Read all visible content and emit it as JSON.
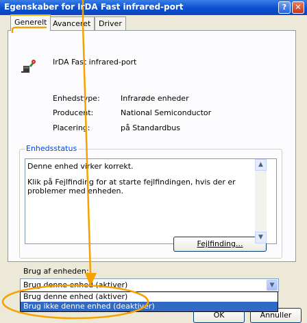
{
  "window": {
    "title": "Egenskaber for IrDA Fast infrared-port",
    "help_glyph": "?",
    "close_glyph": "✕"
  },
  "tabs": [
    {
      "label": "Generelt",
      "selected": true
    },
    {
      "label": "Avanceret",
      "selected": false
    },
    {
      "label": "Driver",
      "selected": false
    }
  ],
  "device": {
    "name": "IrDA Fast infrared-port",
    "icon": "infrared-device-icon"
  },
  "properties": [
    {
      "label": "Enhedstype:",
      "value": "Infrarøde enheder"
    },
    {
      "label": "Producent:",
      "value": "National Semiconductor"
    },
    {
      "label": "Placering:",
      "value": "på Standardbus"
    }
  ],
  "status": {
    "group_title": "Enhedsstatus",
    "line1": "Denne enhed virker korrekt.",
    "line2": "Klik på Fejlfinding for at starte fejlfindingen, hvis der er problemer med enheden.",
    "troubleshoot_button": "Fejlfinding..."
  },
  "usage": {
    "label": "Brug af enheden:",
    "selected_value": "Brug denne enhed (aktiver)",
    "options": [
      "Brug denne enhed (aktiver)",
      "Brug ikke denne enhed (deaktiver)"
    ],
    "highlighted_option_index": 1
  },
  "buttons": {
    "ok": "OK",
    "cancel": "Annuller"
  },
  "colors": {
    "annotation": "#f5a200",
    "selection": "#316ac5",
    "titlebar": "#0a4fd0"
  }
}
